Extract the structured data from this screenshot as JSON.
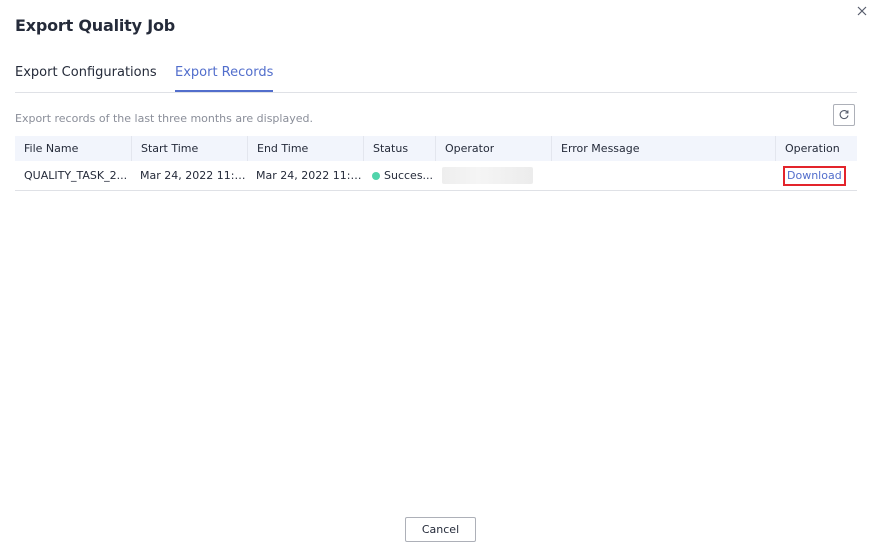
{
  "dialog": {
    "title": "Export Quality Job",
    "close_icon": "close-icon"
  },
  "tabs": [
    {
      "label": "Export Configurations",
      "active": false
    },
    {
      "label": "Export Records",
      "active": true
    }
  ],
  "records": {
    "hint": "Export records of the last three months are displayed.",
    "refresh_icon": "refresh-icon",
    "columns": [
      "File Name",
      "Start Time",
      "End Time",
      "Status",
      "Operator",
      "Error Message",
      "Operation"
    ],
    "rows": [
      {
        "file_name": "QUALITY_TASK_2...",
        "start_time": "Mar 24, 2022 11:1...",
        "end_time": "Mar 24, 2022 11:1...",
        "status": "Succes...",
        "operator": "",
        "error_message": "",
        "operation": "Download"
      }
    ]
  },
  "footer": {
    "cancel_label": "Cancel"
  },
  "colors": {
    "accent": "#526ecc",
    "success": "#50d4ab",
    "highlight_box": "#e3242b",
    "header_bg": "#f2f5fc"
  }
}
